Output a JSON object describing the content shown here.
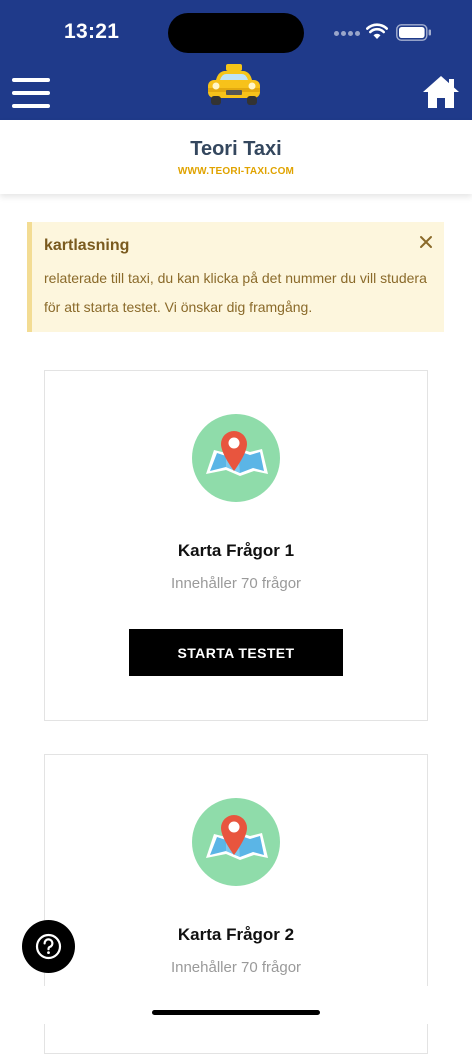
{
  "status_bar": {
    "time": "13:21"
  },
  "app_bar": {
    "menu_icon": "hamburger-menu-icon",
    "logo_icon": "taxi-car-icon",
    "home_icon": "home-icon"
  },
  "header": {
    "title": "Teori Taxi",
    "url": "WWW.TEORI-TAXI.COM"
  },
  "alert": {
    "title": "kartlasning",
    "text": "relaterade till taxi, du kan klicka på det nummer du vill studera för att starta testet. Vi önskar dig framgång.",
    "close_icon": "close-icon"
  },
  "cards": [
    {
      "icon": "map-pin-icon",
      "title": "Karta Frågor 1",
      "subtitle": "Innehåller 70 frågor",
      "button_label": "STARTA TESTET"
    },
    {
      "icon": "map-pin-icon",
      "title": "Karta Frågor 2",
      "subtitle": "Innehåller 70 frågor"
    }
  ],
  "help_button": {
    "icon": "help-question-icon"
  },
  "colors": {
    "app_bar": "#1f3a8a",
    "alert_bg": "#fdf6dd",
    "alert_border": "#f3dc93",
    "url_accent": "#e0a300",
    "map_circle": "#8fdcaa",
    "pin": "#e8553e",
    "button": "#000000"
  }
}
